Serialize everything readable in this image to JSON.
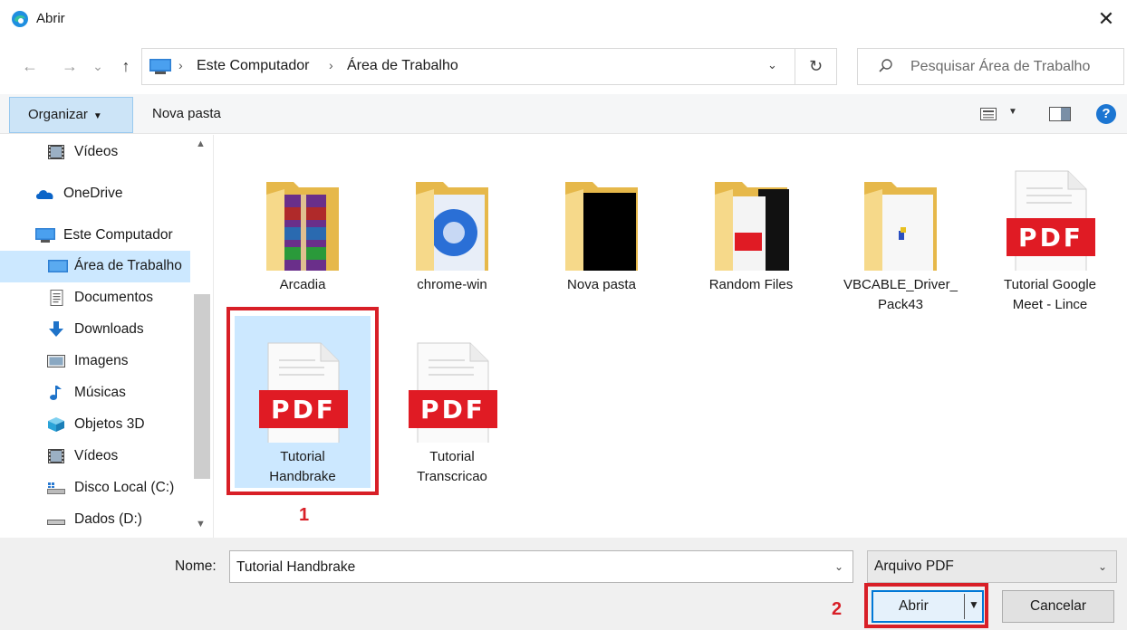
{
  "window": {
    "title": "Abrir",
    "close_glyph": "✕"
  },
  "nav": {
    "back": "←",
    "forward": "→",
    "recent": "⌄",
    "up": "↑"
  },
  "address": {
    "crumbs": [
      "Este Computador",
      "Área de Trabalho"
    ],
    "separator": "›",
    "dropdown": "⌄",
    "refresh": "↻"
  },
  "search": {
    "placeholder": "Pesquisar Área de Trabalho"
  },
  "toolbar": {
    "organize_label": "Organizar",
    "new_folder_label": "Nova pasta",
    "help": "?"
  },
  "sidebar": {
    "items": [
      {
        "label": "Vídeos",
        "icon": "video-icon"
      },
      {
        "label": "OneDrive",
        "icon": "cloud-icon"
      },
      {
        "label": "Este Computador",
        "icon": "computer-icon"
      },
      {
        "label": "Área de Trabalho",
        "icon": "desktop-icon",
        "selected": true
      },
      {
        "label": "Documentos",
        "icon": "document-icon"
      },
      {
        "label": "Downloads",
        "icon": "download-icon"
      },
      {
        "label": "Imagens",
        "icon": "image-icon"
      },
      {
        "label": "Músicas",
        "icon": "music-icon"
      },
      {
        "label": "Objetos 3D",
        "icon": "cube-icon"
      },
      {
        "label": "Vídeos",
        "icon": "video-icon"
      },
      {
        "label": "Disco Local (C:)",
        "icon": "drive-icon"
      },
      {
        "label": "Dados (D:)",
        "icon": "drive-icon"
      }
    ]
  },
  "files": [
    {
      "line1": "Arcadia",
      "line2": "",
      "type": "folder",
      "icon": "folder-archive-icon"
    },
    {
      "line1": "chrome-win",
      "line2": "",
      "type": "folder",
      "icon": "folder-chrome-icon"
    },
    {
      "line1": "Nova pasta",
      "line2": "",
      "type": "folder",
      "icon": "folder-black-icon"
    },
    {
      "line1": "Random Files",
      "line2": "",
      "type": "folder",
      "icon": "folder-pdf-icon"
    },
    {
      "line1": "VBCABLE_Driver_",
      "line2": "Pack43",
      "type": "folder",
      "icon": "folder-docs-icon"
    },
    {
      "line1": "Tutorial Google",
      "line2": "Meet - Lince",
      "type": "pdf",
      "icon": "pdf-file-icon"
    },
    {
      "line1": "Tutorial",
      "line2": "Handbrake",
      "type": "pdf",
      "icon": "pdf-file-icon",
      "selected": true
    },
    {
      "line1": "Tutorial",
      "line2": "Transcricao",
      "type": "pdf",
      "icon": "pdf-file-icon"
    }
  ],
  "pdf_label": "PDF",
  "annotations": {
    "step1": "1",
    "step2": "2"
  },
  "bottom": {
    "name_label": "Nome:",
    "name_value": "Tutorial Handbrake",
    "file_type": "Arquivo PDF",
    "open_label": "Abrir",
    "cancel_label": "Cancelar",
    "dropdown": "⌄"
  },
  "colors": {
    "accent": "#0078d7",
    "selection": "#cce8ff",
    "highlight": "#d81f27",
    "pdf_red": "#e01b24"
  }
}
